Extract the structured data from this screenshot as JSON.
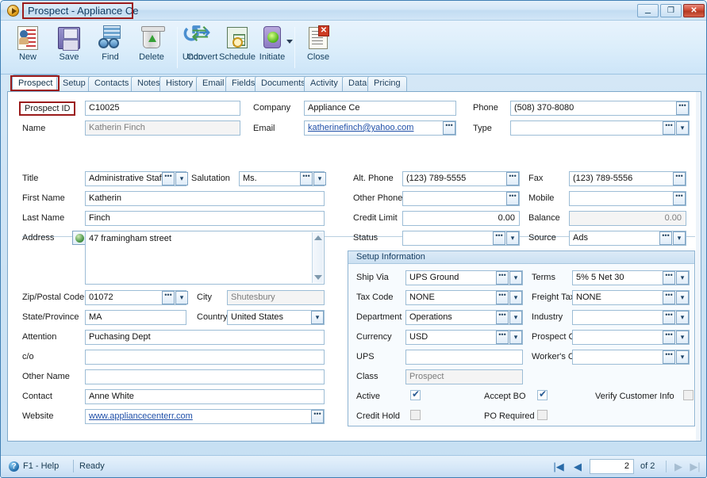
{
  "window": {
    "title": "Prospect - Appliance Ce",
    "app_icon": "play-circle-icon",
    "controls": {
      "minimize": "–",
      "maximize": "❐",
      "close": "✕"
    }
  },
  "toolbar": {
    "items": [
      {
        "label": "New",
        "icon": "new-record-icon"
      },
      {
        "label": "Save",
        "icon": "floppy-save-icon"
      },
      {
        "label": "Find",
        "icon": "binoculars-find-icon"
      },
      {
        "label": "Delete",
        "icon": "recycle-bin-delete-icon"
      },
      {
        "label": "Undo",
        "icon": "undo-arrow-icon"
      },
      {
        "label": "Convert",
        "icon": "convert-arrows-icon"
      },
      {
        "label": "Schedule",
        "icon": "schedule-calendar-clock-icon"
      },
      {
        "label": "Initiate",
        "icon": "traffic-light-initiate-icon",
        "has_dropdown": true
      },
      {
        "label": "Close",
        "icon": "close-document-icon"
      }
    ]
  },
  "tabs": [
    {
      "label": "Prospect",
      "active": true
    },
    {
      "label": "Setup",
      "active": false
    },
    {
      "label": "Contacts",
      "active": false
    },
    {
      "label": "Notes",
      "active": false
    },
    {
      "label": "History",
      "active": false
    },
    {
      "label": "Email",
      "active": false
    },
    {
      "label": "Fields",
      "active": false
    },
    {
      "label": "Documents",
      "active": false
    },
    {
      "label": "Activity",
      "active": false
    },
    {
      "label": "Data",
      "active": false
    },
    {
      "label": "Pricing",
      "active": false
    }
  ],
  "highlights": {
    "color": "#9b1c1c"
  },
  "form": {
    "header": {
      "prospect_id_label": "Prospect ID",
      "prospect_id_value": "C10025",
      "name_label": "Name",
      "name_value": "Katherin Finch",
      "company_label": "Company",
      "company_value": "Appliance Ce",
      "email_label": "Email",
      "email_value": "katherinefinch@yahoo.com",
      "phone_label": "Phone",
      "phone_value": "(508) 370-8080",
      "type_label": "Type",
      "type_value": ""
    },
    "left": {
      "title_label": "Title",
      "title_value": "Administrative Staf",
      "salutation_label": "Salutation",
      "salutation_value": "Ms.",
      "first_name_label": "First Name",
      "first_name_value": "Katherin",
      "last_name_label": "Last Name",
      "last_name_value": "Finch",
      "address_label": "Address",
      "address_value": "47 framingham street",
      "zip_label": "Zip/Postal Code",
      "zip_value": "01072",
      "city_label": "City",
      "city_value": "Shutesbury",
      "state_label": "State/Province",
      "state_value": "MA",
      "country_label": "Country",
      "country_value": "United States",
      "attention_label": "Attention",
      "attention_value": "Puchasing Dept",
      "co_label": "c/o",
      "co_value": "",
      "other_name_label": "Other Name",
      "other_name_value": "",
      "contact_label": "Contact",
      "contact_value": "Anne White",
      "website_label": "Website",
      "website_value": "www.appliancecenterr.com"
    },
    "right": {
      "alt_phone_label": "Alt. Phone",
      "alt_phone_value": "(123) 789-5555",
      "fax_label": "Fax",
      "fax_value": "(123) 789-5556",
      "other_phone_label": "Other Phone",
      "other_phone_value": "",
      "mobile_label": "Mobile",
      "mobile_value": "",
      "credit_limit_label": "Credit Limit",
      "credit_limit_value": "0.00",
      "balance_label": "Balance",
      "balance_value": "0.00",
      "status_label": "Status",
      "status_value": "",
      "source_label": "Source",
      "source_value": "Ads"
    },
    "setup": {
      "group_title": "Setup Information",
      "ship_via_label": "Ship Via",
      "ship_via_value": "UPS Ground",
      "terms_label": "Terms",
      "terms_value": "5% 5 Net 30",
      "tax_code_label": "Tax Code",
      "tax_code_value": "NONE",
      "freight_tax_label": "Freight Tax",
      "freight_tax_value": "NONE",
      "department_label": "Department",
      "department_value": "Operations",
      "industry_label": "Industry",
      "industry_value": "",
      "currency_label": "Currency",
      "currency_value": "USD",
      "prospect_code_label": "Prospect Code",
      "prospect_code_value": "",
      "ups_label": "UPS",
      "ups_value": "",
      "workers_code_label": "Worker's Code",
      "workers_code_value": "",
      "class_label": "Class",
      "class_value": "Prospect",
      "active_label": "Active",
      "active_checked": true,
      "accept_bo_label": "Accept BO",
      "accept_bo_checked": true,
      "verify_customer_info_label": "Verify Customer Info",
      "verify_customer_info_checked": false,
      "credit_hold_label": "Credit Hold",
      "credit_hold_checked": false,
      "po_required_label": "PO Required",
      "po_required_checked": false
    }
  },
  "statusbar": {
    "help_icon": "question-help-icon",
    "help_text": "F1 - Help",
    "ready_text": "Ready",
    "nav": {
      "first": "|◀",
      "prev": "◀",
      "page_value": "2",
      "of_text": "of 2",
      "next": "▶",
      "last": "▶|"
    }
  }
}
